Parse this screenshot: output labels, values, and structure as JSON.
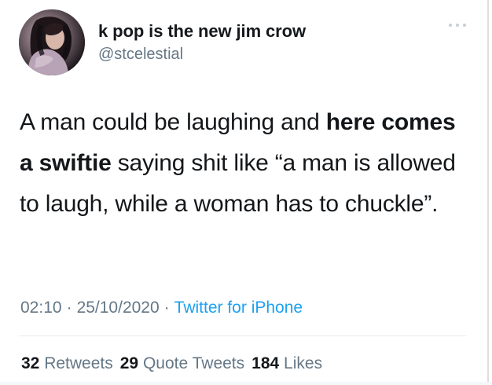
{
  "author": {
    "display_name": "k pop is the new jim crow",
    "handle": "@stcelestial"
  },
  "tweet": {
    "text_segments": [
      {
        "text": "A man could be laughing and ",
        "bold": false
      },
      {
        "text": "here comes a swiftie",
        "bold": true
      },
      {
        "text": " saying shit like “a man is allowed to laugh, while a woman has to chuckle”.",
        "bold": false
      }
    ],
    "time": "02:10",
    "date": "25/10/2020",
    "separator": "·",
    "source": "Twitter for iPhone"
  },
  "stats": {
    "retweets": {
      "count": "32",
      "label": "Retweets"
    },
    "quote_tweets": {
      "count": "29",
      "label": "Quote Tweets"
    },
    "likes": {
      "count": "184",
      "label": "Likes"
    }
  },
  "icons": {
    "more": "more-dots-icon",
    "avatar": "profile-avatar"
  },
  "colors": {
    "text": "#14171a",
    "muted": "#657786",
    "link": "#1da1f2",
    "divider": "#e6ecf0"
  }
}
